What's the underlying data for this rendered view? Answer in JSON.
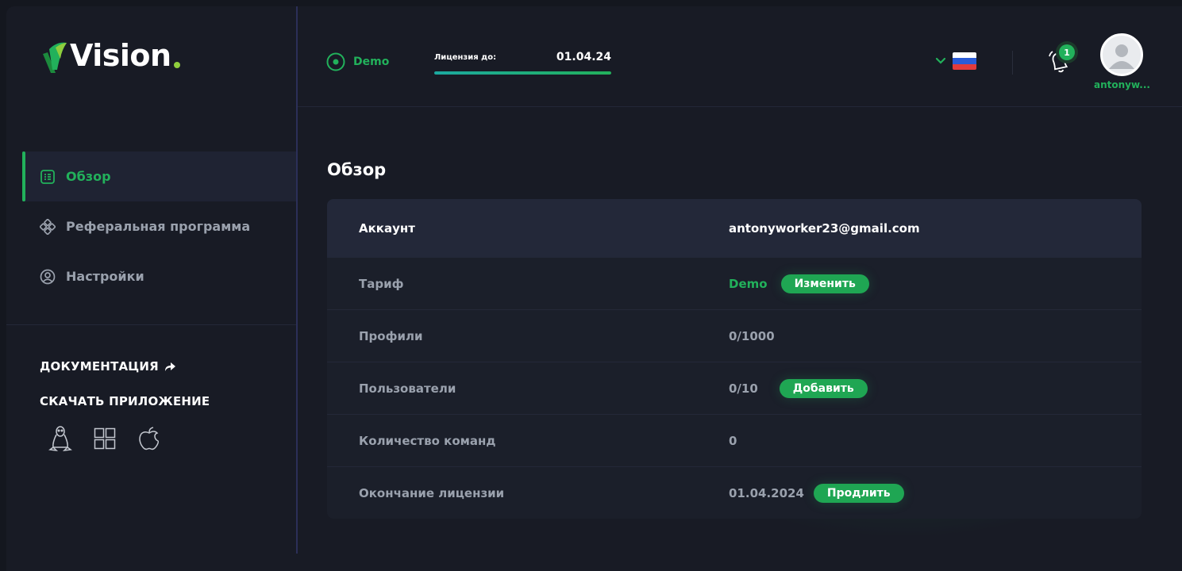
{
  "brand": {
    "name": "Vision"
  },
  "sidebar": {
    "nav": [
      {
        "label": "Обзор",
        "icon": "overview-icon",
        "active": true
      },
      {
        "label": "Реферальная программа",
        "icon": "referral-icon",
        "active": false
      },
      {
        "label": "Настройки",
        "icon": "settings-user-icon",
        "active": false
      }
    ],
    "docs_label": "ДОКУМЕНТАЦИЯ",
    "download_label": "СКАЧАТЬ ПРИЛОЖЕНИЕ",
    "os": [
      "linux-icon",
      "windows-icon",
      "apple-icon"
    ]
  },
  "header": {
    "plan": "Demo",
    "license_label": "Лицензия до:",
    "license_date": "01.04.24",
    "license_progress": 1.0,
    "language_flag": "russia-flag-icon",
    "notifications_count": "1",
    "username": "antonyw..."
  },
  "main": {
    "title": "Обзор",
    "rows": [
      {
        "label": "Аккаунт",
        "value": "antonyworker23@gmail.com"
      },
      {
        "label": "Тариф",
        "value": "Demo",
        "action": "Изменить"
      },
      {
        "label": "Профили",
        "value": "0/1000"
      },
      {
        "label": "Пользователи",
        "value": "0/10",
        "action": "Добавить"
      },
      {
        "label": "Количество команд",
        "value": "0"
      },
      {
        "label": "Окончание лицензии",
        "value": "01.04.2024",
        "action": "Продлить"
      }
    ]
  },
  "colors": {
    "accent": "#22b15b",
    "background": "#181b25",
    "sidebar_divider": "#2b2f58"
  }
}
